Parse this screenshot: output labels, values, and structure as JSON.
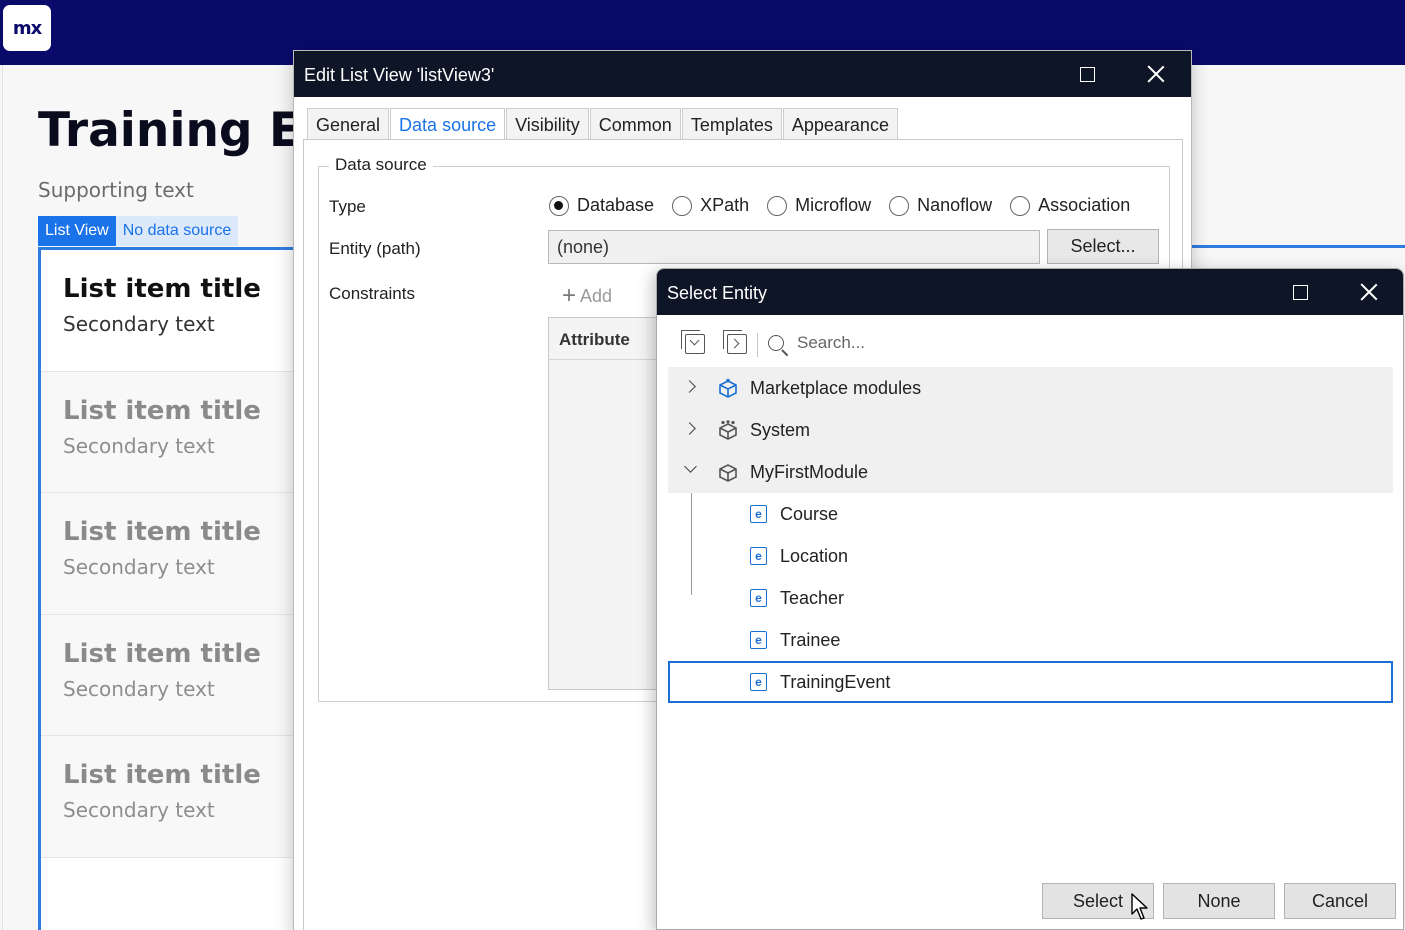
{
  "app": {
    "logo_text": "mx",
    "page_title": "Training Ev",
    "page_subtitle": "Supporting text",
    "list_view_tag": "List View",
    "no_source_tag": "No data source",
    "list_items": [
      {
        "title": "List item title",
        "secondary": "Secondary text"
      },
      {
        "title": "List item title",
        "secondary": "Secondary text"
      },
      {
        "title": "List item title",
        "secondary": "Secondary text"
      },
      {
        "title": "List item title",
        "secondary": "Secondary text"
      },
      {
        "title": "List item title",
        "secondary": "Secondary text"
      }
    ]
  },
  "edit_dialog": {
    "title": "Edit List View 'listView3'",
    "tabs": [
      "General",
      "Data source",
      "Visibility",
      "Common",
      "Templates",
      "Appearance"
    ],
    "active_tab": "Data source",
    "group_legend": "Data source",
    "type_label": "Type",
    "type_options": [
      "Database",
      "XPath",
      "Microflow",
      "Nanoflow",
      "Association"
    ],
    "type_selected": "Database",
    "entity_label": "Entity (path)",
    "entity_value": "(none)",
    "select_button": "Select...",
    "constraints_label": "Constraints",
    "add_label": "Add",
    "attribute_header": "Attribute"
  },
  "select_entity": {
    "title": "Select Entity",
    "search_placeholder": "Search...",
    "modules": [
      {
        "name": "Marketplace modules",
        "expanded": false,
        "icon": "marketplace-module-icon"
      },
      {
        "name": "System",
        "expanded": false,
        "icon": "system-module-icon"
      },
      {
        "name": "MyFirstModule",
        "expanded": true,
        "icon": "module-icon"
      }
    ],
    "entities": [
      "Course",
      "Location",
      "Teacher",
      "Trainee",
      "TrainingEvent"
    ],
    "selected_entity": "TrainingEvent",
    "buttons": {
      "select": "Select",
      "none": "None",
      "cancel": "Cancel"
    }
  },
  "colors": {
    "header_bg": "#0a0a6b",
    "titlebar_bg": "#0d1526",
    "accent": "#1a73e8"
  }
}
